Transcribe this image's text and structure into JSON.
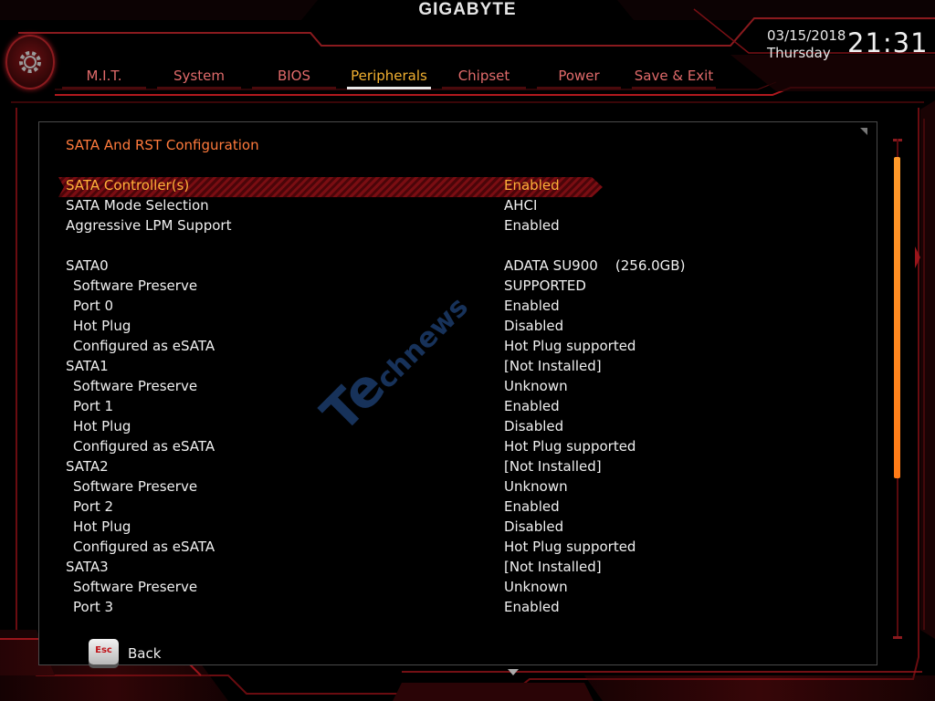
{
  "header": {
    "brand": "GIGABYTE",
    "date": "03/15/2018",
    "day": "Thursday",
    "time": "21:31"
  },
  "tabs": [
    {
      "label": "M.I.T."
    },
    {
      "label": "System"
    },
    {
      "label": "BIOS"
    },
    {
      "label": "Peripherals"
    },
    {
      "label": "Chipset"
    },
    {
      "label": "Power"
    },
    {
      "label": "Save & Exit"
    }
  ],
  "active_tab": "Peripherals",
  "section_title": "SATA And RST Configuration",
  "settings": [
    {
      "label": "SATA Controller(s)",
      "value": "Enabled"
    },
    {
      "label": "SATA Mode Selection",
      "value": "AHCI"
    },
    {
      "label": "Aggressive LPM Support",
      "value": "Enabled"
    },
    {
      "label": "SATA0",
      "value": "ADATA SU900    (256.0GB)"
    },
    {
      "label": "Software Preserve",
      "value": "SUPPORTED"
    },
    {
      "label": "Port 0",
      "value": "Enabled"
    },
    {
      "label": "Hot Plug",
      "value": "Disabled"
    },
    {
      "label": "Configured as eSATA",
      "value": "Hot Plug supported"
    },
    {
      "label": "SATA1",
      "value": "[Not Installed]"
    },
    {
      "label": "Software Preserve",
      "value": "Unknown"
    },
    {
      "label": "Port 1",
      "value": "Enabled"
    },
    {
      "label": "Hot Plug",
      "value": "Disabled"
    },
    {
      "label": "Configured as eSATA",
      "value": "Hot Plug supported"
    },
    {
      "label": "SATA2",
      "value": "[Not Installed]"
    },
    {
      "label": "Software Preserve",
      "value": "Unknown"
    },
    {
      "label": "Port 2",
      "value": "Enabled"
    },
    {
      "label": "Hot Plug",
      "value": "Disabled"
    },
    {
      "label": "Configured as eSATA",
      "value": "Hot Plug supported"
    },
    {
      "label": "SATA3",
      "value": "[Not Installed]"
    },
    {
      "label": "Software Preserve",
      "value": "Unknown"
    },
    {
      "label": "Port 3",
      "value": "Enabled"
    }
  ],
  "footer": {
    "esc_key": "Esc",
    "back_label": "Back"
  },
  "watermark": {
    "big": "Te",
    "small": "chnews"
  },
  "colors": {
    "accent_red": "#c0141a",
    "selected_text": "#ffb13a",
    "section_title": "#ff7a3c",
    "scroll_thumb": "#ff8a1f"
  }
}
